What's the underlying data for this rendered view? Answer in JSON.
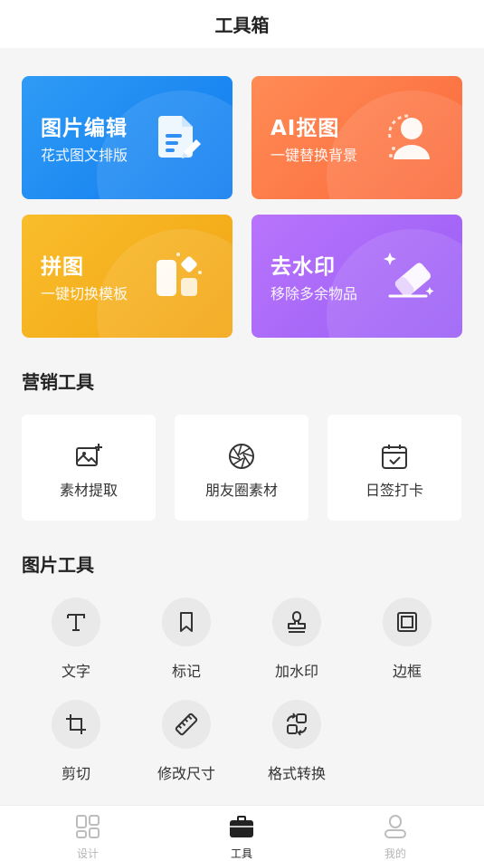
{
  "header": {
    "title": "工具箱"
  },
  "features": [
    {
      "title": "图片编辑",
      "subtitle": "花式图文排版",
      "icon": "document-edit-icon",
      "color": "#1a86f2"
    },
    {
      "title": "AI抠图",
      "subtitle": "一键替换背景",
      "icon": "person-cutout-icon",
      "color": "#fd7747"
    },
    {
      "title": "拼图",
      "subtitle": "一键切换模板",
      "icon": "collage-blocks-icon",
      "color": "#f5b01e"
    },
    {
      "title": "去水印",
      "subtitle": "移除多余物品",
      "icon": "eraser-icon",
      "color": "#a866f8"
    }
  ],
  "marketing": {
    "title": "营销工具",
    "items": [
      {
        "label": "素材提取",
        "icon": "image-add-icon"
      },
      {
        "label": "朋友圈素材",
        "icon": "aperture-icon"
      },
      {
        "label": "日签打卡",
        "icon": "calendar-check-icon"
      }
    ]
  },
  "image_tools": {
    "title": "图片工具",
    "items": [
      {
        "label": "文字",
        "icon": "text-icon"
      },
      {
        "label": "标记",
        "icon": "bookmark-icon"
      },
      {
        "label": "加水印",
        "icon": "stamp-icon"
      },
      {
        "label": "边框",
        "icon": "frame-icon"
      },
      {
        "label": "剪切",
        "icon": "crop-icon"
      },
      {
        "label": "修改尺寸",
        "icon": "ruler-icon"
      },
      {
        "label": "格式转换",
        "icon": "convert-icon"
      }
    ]
  },
  "tabbar": {
    "items": [
      {
        "label": "设计",
        "icon": "grid-icon",
        "active": false
      },
      {
        "label": "工具",
        "icon": "toolbox-icon",
        "active": true
      },
      {
        "label": "我的",
        "icon": "user-icon",
        "active": false
      }
    ]
  }
}
